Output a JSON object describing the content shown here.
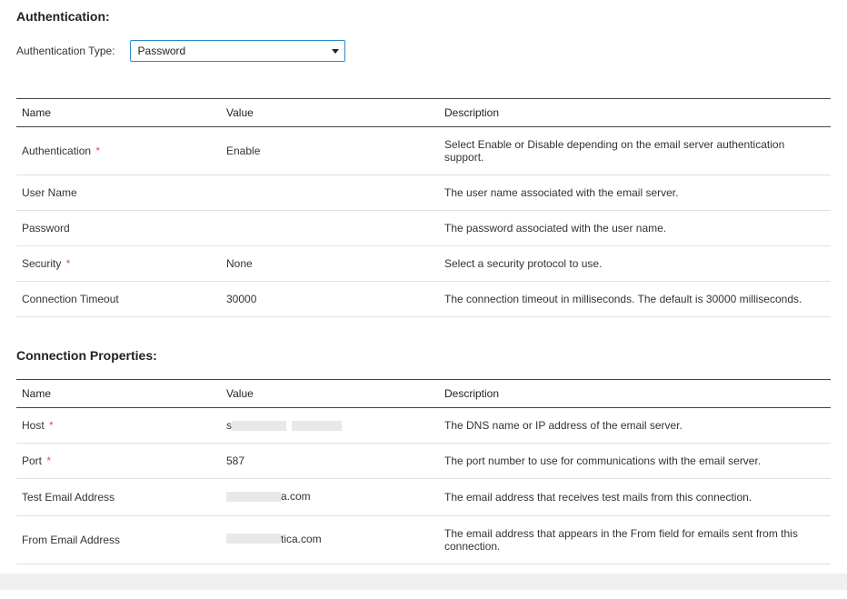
{
  "authSection": {
    "title": "Authentication:",
    "typeLabel": "Authentication Type:",
    "typeValue": "Password"
  },
  "authTable": {
    "headers": {
      "name": "Name",
      "value": "Value",
      "description": "Description"
    },
    "rows": [
      {
        "name": "Authentication",
        "required": true,
        "value": "Enable",
        "description": "Select Enable or Disable depending on the email server authentication support."
      },
      {
        "name": "User Name",
        "required": false,
        "value": "",
        "description": "The user name associated with the email server."
      },
      {
        "name": "Password",
        "required": false,
        "value": "",
        "description": "The password associated with the user name."
      },
      {
        "name": "Security",
        "required": true,
        "value": "None",
        "description": "Select a security protocol to use."
      },
      {
        "name": "Connection Timeout",
        "required": false,
        "value": "30000",
        "description": "The connection timeout in milliseconds. The default is 30000 milliseconds."
      }
    ]
  },
  "connSection": {
    "title": "Connection Properties:"
  },
  "connTable": {
    "headers": {
      "name": "Name",
      "value": "Value",
      "description": "Description"
    },
    "rows": [
      {
        "name": "Host",
        "required": true,
        "valuePrefix": "s",
        "valueSuffix": "",
        "redacted": true,
        "description": "The DNS name or IP address of the email server."
      },
      {
        "name": "Port",
        "required": true,
        "valuePrefix": "587",
        "valueSuffix": "",
        "redacted": false,
        "description": "The port number to use for communications with the email server."
      },
      {
        "name": "Test Email Address",
        "required": false,
        "valuePrefix": "",
        "valueSuffix": "a.com",
        "redacted": true,
        "description": "The email address that receives test mails from this connection."
      },
      {
        "name": "From Email Address",
        "required": false,
        "valuePrefix": "",
        "valueSuffix": "tica.com",
        "redacted": true,
        "description": "The email address that appears in the From field for emails sent from this connection."
      }
    ]
  }
}
